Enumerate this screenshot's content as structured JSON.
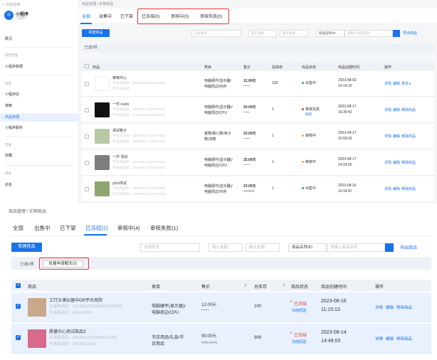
{
  "top": {
    "sidebar": {
      "back": "< 内容应用",
      "brand": "小程序",
      "brand_sub": "小程序",
      "items": [
        {
          "label": "概况",
          "group": false,
          "active": false
        },
        {
          "label": "经营管理",
          "group": true,
          "active": false
        },
        {
          "label": "小程序数据",
          "group": false,
          "active": false
        },
        {
          "label": "经营",
          "group": true,
          "active": false
        },
        {
          "label": "小程序店",
          "group": false,
          "active": false
        },
        {
          "label": "搜索",
          "group": false,
          "active": false
        },
        {
          "label": "商品管理",
          "group": false,
          "active": true
        },
        {
          "label": "小程序服务",
          "group": false,
          "active": false
        },
        {
          "label": "客服",
          "group": true,
          "active": false
        },
        {
          "label": "收藏",
          "group": false,
          "active": false
        },
        {
          "label": "目录",
          "group": true,
          "active": false
        },
        {
          "label": "店名",
          "group": false,
          "active": false
        }
      ]
    },
    "breadcrumb": "商品管理 / 实物商品",
    "tabs": [
      "全部",
      "出售中",
      "已下架",
      "已冻结(0)",
      "审核中(0)",
      "审核失败(0)"
    ],
    "new_button": "新建商品",
    "filters": {
      "category": "全部类目",
      "min_price": "最小金额",
      "max_price": "最大金额",
      "name_select": "商品名称/ID",
      "name_input": "请输入商品名称"
    },
    "export": "导出商品",
    "selected": "已选0项",
    "headers": [
      "商品",
      "类目",
      "售价",
      "总库存",
      "商品状态",
      "商品创建时间",
      "操作"
    ],
    "rows": [
      {
        "name": "审核中心",
        "line2": "平台商品码：20230800001572980",
        "line3": "平台商品码：",
        "category1": "电脑硬件/显示器/",
        "category2": "电脑周边/内存",
        "price": "12.00元",
        "price_orig": "——",
        "stock": "128",
        "status": "出售中",
        "status_color": "#34a853",
        "status_sub": "",
        "date": "2023-08-03",
        "time": "14:14:10",
        "actions": [
          "详情",
          "编辑",
          "更多∨"
        ],
        "thumb": "#ffffff"
      },
      {
        "name": "一件 ceshi",
        "line2": "平台商品码：20230817165057860",
        "line3": "平台商品码：20230817165057860",
        "category1": "电脑硬件(显示器)/",
        "category2": "电脑周边/CPU",
        "price": "24.00元",
        "price_orig": "——",
        "stock": "1",
        "status": "审核失败",
        "status_color": "#e53935",
        "status_sub": "原因",
        "date": "2023-08-17",
        "time": "16:30:42",
        "actions": [
          "详情",
          "编辑",
          "移除商品"
        ],
        "thumb": "#111111"
      },
      {
        "name": "测试鞋子",
        "line2": "平台商品码：20230817163071882",
        "line3": "平台商品码：20230817163071882",
        "category1": "童鞋/婴儿鞋/亲子",
        "category2": "鞋/凉鞋",
        "price": "23.00元",
        "price_orig": "——",
        "stock": "1",
        "status": "审核中",
        "status_color": "#f9a825",
        "status_sub": "",
        "date": "2023-08-17",
        "time": "15:00:03",
        "actions": [
          "详情",
          "编辑",
          "移除商品"
        ],
        "thumb": "#b9c7a4"
      },
      {
        "name": "一件 测试",
        "line2": "平台商品码：20230817163071892",
        "line3": "平台商品码：20230817163071892",
        "category1": "电脑硬件(显示器)/",
        "category2": "电脑周边/CPU",
        "price": "25.00元",
        "price_orig": "——",
        "stock": "1",
        "status": "审核中",
        "status_color": "#f9a825",
        "status_sub": "",
        "date": "2023-08-17",
        "time": "14:24:25",
        "actions": [
          "详情",
          "编辑",
          "移除商品"
        ],
        "thumb": "#7e7e7e"
      },
      {
        "name": "yichi测试",
        "line2": "平台商品码：20230817163071888",
        "line3": "平台商品码：20230817163071888",
        "category1": "电脑硬件(显示器)/",
        "category2": "电脑周边/内存",
        "price": "23.00元",
        "price_orig": "44.00元",
        "stock": "1",
        "status": "出售中",
        "status_color": "#34a853",
        "status_sub": "",
        "date": "2023-08-16",
        "time": "19:14:41",
        "actions": [
          "详情",
          "编辑",
          "移除商品"
        ],
        "thumb": "#8fa66e"
      }
    ]
  },
  "bottom": {
    "breadcrumb": "商品管理 / 实物商品",
    "tabs": [
      "全部",
      "出售中",
      "已下架",
      "已冻结(2)",
      "审核中(4)",
      "审核失败(1)"
    ],
    "new_button": "新建商品",
    "filters": {
      "category": "全部类目",
      "min_price": "最小金额",
      "max_price": "最大金额",
      "name_select": "商品名称/ID",
      "name_input": "请输入商品名称"
    },
    "export": "导出商品",
    "selected": "已选2项",
    "batch_button": "批量申请解冻(2)",
    "headers": [
      "商品",
      "类目",
      "售价",
      "总库存",
      "商品状态",
      "商品创建时间",
      "操作"
    ],
    "rows": [
      {
        "name": "工行沙漠仪器中GR平台风险",
        "line2": "平台商品码：20230816220002015537880",
        "line3": "平台商品码：454747654",
        "category1": "电脑硬件(显示器)/",
        "category2": "电脑周边/CPU",
        "price": "12.00元",
        "price_orig": "——",
        "stock": "100",
        "status": "已冻结",
        "status_sub": "冻结原因",
        "date": "2023-08-16",
        "time": "11:15:13",
        "actions": [
          "详情",
          "编辑",
          "移除商品"
        ],
        "thumb": "#c9a98a"
      },
      {
        "name": "质量中心测试商品3",
        "line2": "平台商品码：20230814220002015185I",
        "line3": "平台商品码：20230814003",
        "category1": "节庆用品/礼品/节",
        "category2": "日用品",
        "price": "99.00元",
        "price_orig": "999.00元",
        "stock": "999",
        "status": "已冻结",
        "status_sub": "冻结原因",
        "date": "2023-08-14",
        "time": "14:49:03",
        "actions": [
          "详情",
          "编辑",
          "移除商品"
        ],
        "thumb": "#d86b8a"
      }
    ]
  }
}
